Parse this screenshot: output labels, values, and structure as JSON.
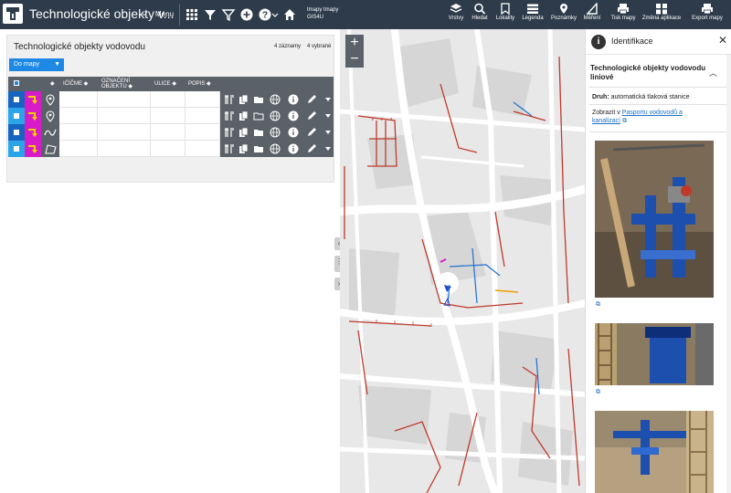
{
  "app": {
    "title": "Technologické objekty v...",
    "menu_label": "Menu",
    "user_label": "tmapy tmapy GIS4U"
  },
  "toolbar": {
    "tools": [
      {
        "label": "Vrstvy",
        "icon": "layers-icon"
      },
      {
        "label": "Hledat",
        "icon": "search-icon"
      },
      {
        "label": "Lokality",
        "icon": "bookmark-icon"
      },
      {
        "label": "Legenda",
        "icon": "list-icon"
      },
      {
        "label": "Poznámky",
        "icon": "pin-icon"
      },
      {
        "label": "Měření",
        "icon": "ruler-icon"
      },
      {
        "label": "Tisk mapy",
        "icon": "print-icon"
      },
      {
        "label": "Změna aplikace",
        "icon": "grid-icon"
      },
      {
        "label": "Export mapy",
        "icon": "print-icon"
      }
    ]
  },
  "table_panel": {
    "title": "Technologické objekty vodovodu",
    "records": "4 záznamy",
    "selected": "4 vybrané",
    "to_map_label": "Do mapy",
    "columns": [
      "IČÍČME",
      "OZNAČENÍ OBJEKTU",
      "ULICE",
      "POPIS"
    ],
    "rows": [
      {
        "checkbox_color": "#1565c0",
        "geometry": "point-icon"
      },
      {
        "checkbox_color": "#2aa6e8",
        "geometry": "point-icon"
      },
      {
        "checkbox_color": "#1565c0",
        "geometry": "line-icon"
      },
      {
        "checkbox_color": "#2aa6e8",
        "geometry": "polygon-icon"
      }
    ]
  },
  "identify_panel": {
    "title": "Identifikace",
    "section_title": "Technologické objekty vodovodu liniové",
    "druh_label": "Druh:",
    "druh_value": "automatická tlaková stanice",
    "zobrazit_text": "Zobrazit v",
    "zobrazit_link": "Pasportu vodovodů a kanalizací"
  },
  "colors": {
    "topbar": "#2d3b4a",
    "accent": "#1e88e5",
    "symbol_magenta": "#d81bc8",
    "symbol_yellow": "#f5d200",
    "pipe_red": "#c0392b"
  }
}
